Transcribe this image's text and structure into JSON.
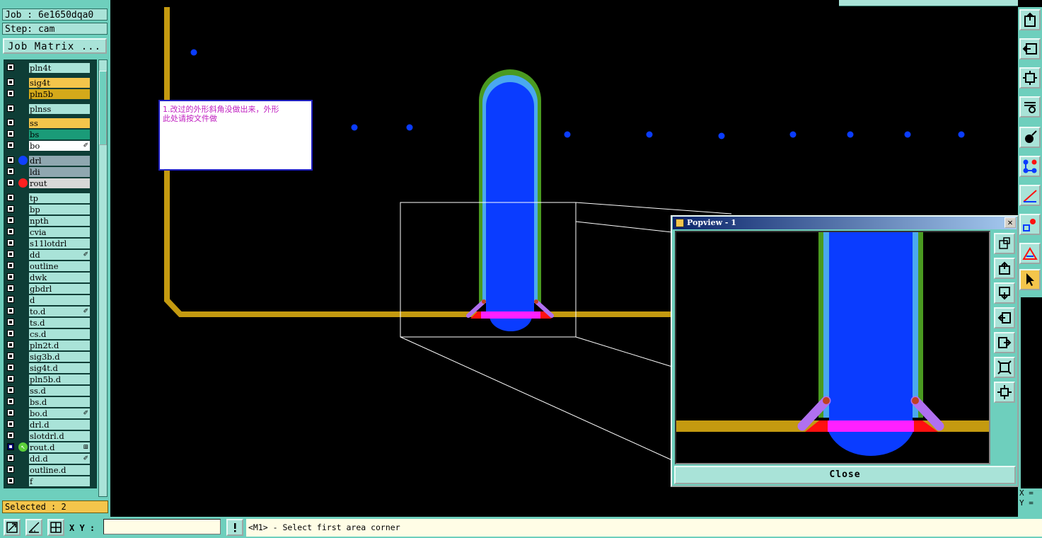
{
  "job_label": "Job : 6e1650dqa0",
  "step_label": "Step: cam",
  "job_matrix_button": "Job Matrix ...",
  "selected_status": "Selected : 2",
  "layers": [
    {
      "name": "pln4t",
      "color": "#a9e3d8"
    },
    {
      "name": "sig4t",
      "color": "#f4c54b"
    },
    {
      "name": "pln5b",
      "color": "#d4a91a"
    },
    {
      "name": "plnss",
      "color": "#a9e3d8"
    },
    {
      "name": "ss",
      "color": "#f4c54b"
    },
    {
      "name": "bs",
      "color": "#1a9b78"
    },
    {
      "name": "bo",
      "color": "#ffffff",
      "mark": "✐"
    },
    {
      "name": "drl",
      "color": "#8fa7b0",
      "dot": "#1040ff"
    },
    {
      "name": "ldi",
      "color": "#8fa7b0"
    },
    {
      "name": "rout",
      "color": "#d8d8d8",
      "dot": "#ff2020"
    },
    {
      "name": "tp",
      "color": "#a9e3d8"
    },
    {
      "name": "bp",
      "color": "#a9e3d8"
    },
    {
      "name": "npth",
      "color": "#a9e3d8"
    },
    {
      "name": "cvia",
      "color": "#a9e3d8"
    },
    {
      "name": "s11lotdrl",
      "color": "#a9e3d8"
    },
    {
      "name": "dd",
      "color": "#a9e3d8",
      "mark": "✐"
    },
    {
      "name": "outline",
      "color": "#a9e3d8"
    },
    {
      "name": "dwk",
      "color": "#a9e3d8"
    },
    {
      "name": "gbdrl",
      "color": "#a9e3d8"
    },
    {
      "name": "d",
      "color": "#a9e3d8"
    },
    {
      "name": "to.d",
      "color": "#a9e3d8",
      "mark": "✐"
    },
    {
      "name": "ts.d",
      "color": "#a9e3d8"
    },
    {
      "name": "cs.d",
      "color": "#a9e3d8"
    },
    {
      "name": "pln2t.d",
      "color": "#a9e3d8"
    },
    {
      "name": "sig3b.d",
      "color": "#a9e3d8"
    },
    {
      "name": "sig4t.d",
      "color": "#a9e3d8"
    },
    {
      "name": "pln5b.d",
      "color": "#a9e3d8"
    },
    {
      "name": "ss.d",
      "color": "#a9e3d8"
    },
    {
      "name": "bs.d",
      "color": "#a9e3d8"
    },
    {
      "name": "bo.d",
      "color": "#a9e3d8",
      "mark": "✐"
    },
    {
      "name": "drl.d",
      "color": "#a9e3d8"
    },
    {
      "name": "slotdrl.d",
      "color": "#a9e3d8"
    },
    {
      "name": "rout.d",
      "color": "#a9e3d8",
      "mark": "⊞",
      "selected": true,
      "arrow": true
    },
    {
      "name": "dd.d",
      "color": "#a9e3d8",
      "mark": "✐"
    },
    {
      "name": "outline.d",
      "color": "#a9e3d8"
    },
    {
      "name": "f",
      "color": "#a9e3d8"
    }
  ],
  "note_text": "1.改过的外形斜角没做出来，外形\n此处请按文件做",
  "popview": {
    "title": "Popview - 1",
    "close_label": "Close",
    "close_x": "✕"
  },
  "xy_label": "X Y :",
  "xy_input_value": "",
  "status_message": "<M1> - Select first area corner",
  "readout": {
    "x": "X =",
    "y": "Y ="
  },
  "icons": {
    "right_toolbar": [
      "zoom-in-icon",
      "zoom-out-icon",
      "zoom-fit-icon",
      "tools-icon",
      "single-select-icon",
      "net-select-icon",
      "measure-icon",
      "feature-icon",
      "snap-icon",
      "pointer-icon"
    ],
    "popview_toolbar": [
      "popview-zoom-icon",
      "popview-up-icon",
      "popview-down-icon",
      "popview-left-icon",
      "popview-right-icon",
      "popview-fit-icon",
      "popview-center-icon"
    ],
    "bottom": [
      "zoom-area-icon",
      "measure-ruler-icon",
      "grid-snap-icon"
    ]
  },
  "colors": {
    "panel": "#6ecfbd",
    "highlight": "#f4c54b",
    "outline_track": "#c49a10",
    "pad_fill": "#0a3cff",
    "pad_cyan": "#4aa8f0",
    "pad_green": "#4a9a20",
    "magenta": "#ff20ff",
    "red": "#ff1010",
    "purple": "#b070f0",
    "via_dot": "#0a3cff"
  }
}
